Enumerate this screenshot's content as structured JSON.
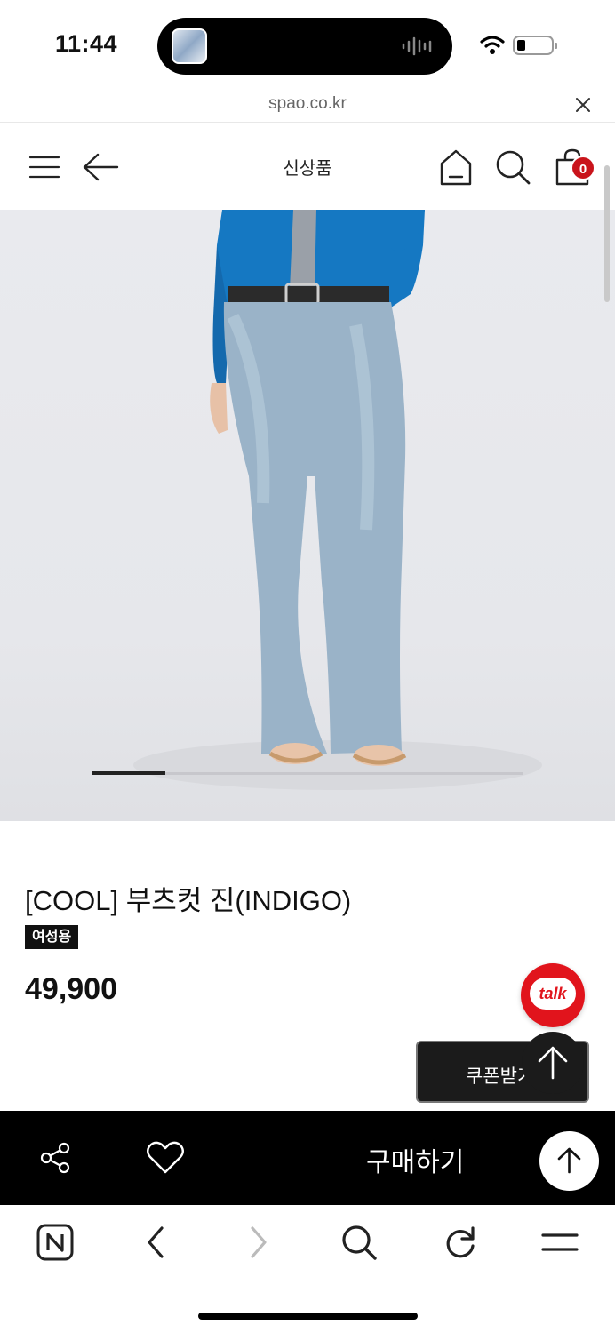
{
  "status_bar": {
    "time": "11:44",
    "icons": [
      "now-playing-thumbnail",
      "audio-wave-icon",
      "wifi-icon",
      "battery-icon"
    ]
  },
  "browser": {
    "url": "spao.co.kr",
    "close_icon": "close-icon"
  },
  "header": {
    "title": "신상품",
    "icons": [
      "menu-icon",
      "back-arrow-icon",
      "home-icon",
      "search-icon",
      "shopping-bag-icon"
    ],
    "cart_count": "0"
  },
  "gallery": {
    "current_slide_fraction": 0.17
  },
  "product": {
    "name": "[COOL] 부츠컷 진(INDIGO)",
    "tag": "여성용",
    "price": "49,900"
  },
  "floating": {
    "talk_label": "talk",
    "coupon_label": "쿠폰받기"
  },
  "buy_bar": {
    "buy_label": "구매하기",
    "icons": [
      "share-icon",
      "heart-icon",
      "scroll-top-icon"
    ]
  },
  "browser_nav": {
    "icons": [
      "naver-icon",
      "nav-back-icon",
      "nav-forward-icon",
      "search-icon",
      "refresh-icon",
      "menu-icon"
    ]
  },
  "colors": {
    "accent_red": "#c9141b",
    "bar_black": "#000000",
    "talk_red": "#e1141c"
  }
}
